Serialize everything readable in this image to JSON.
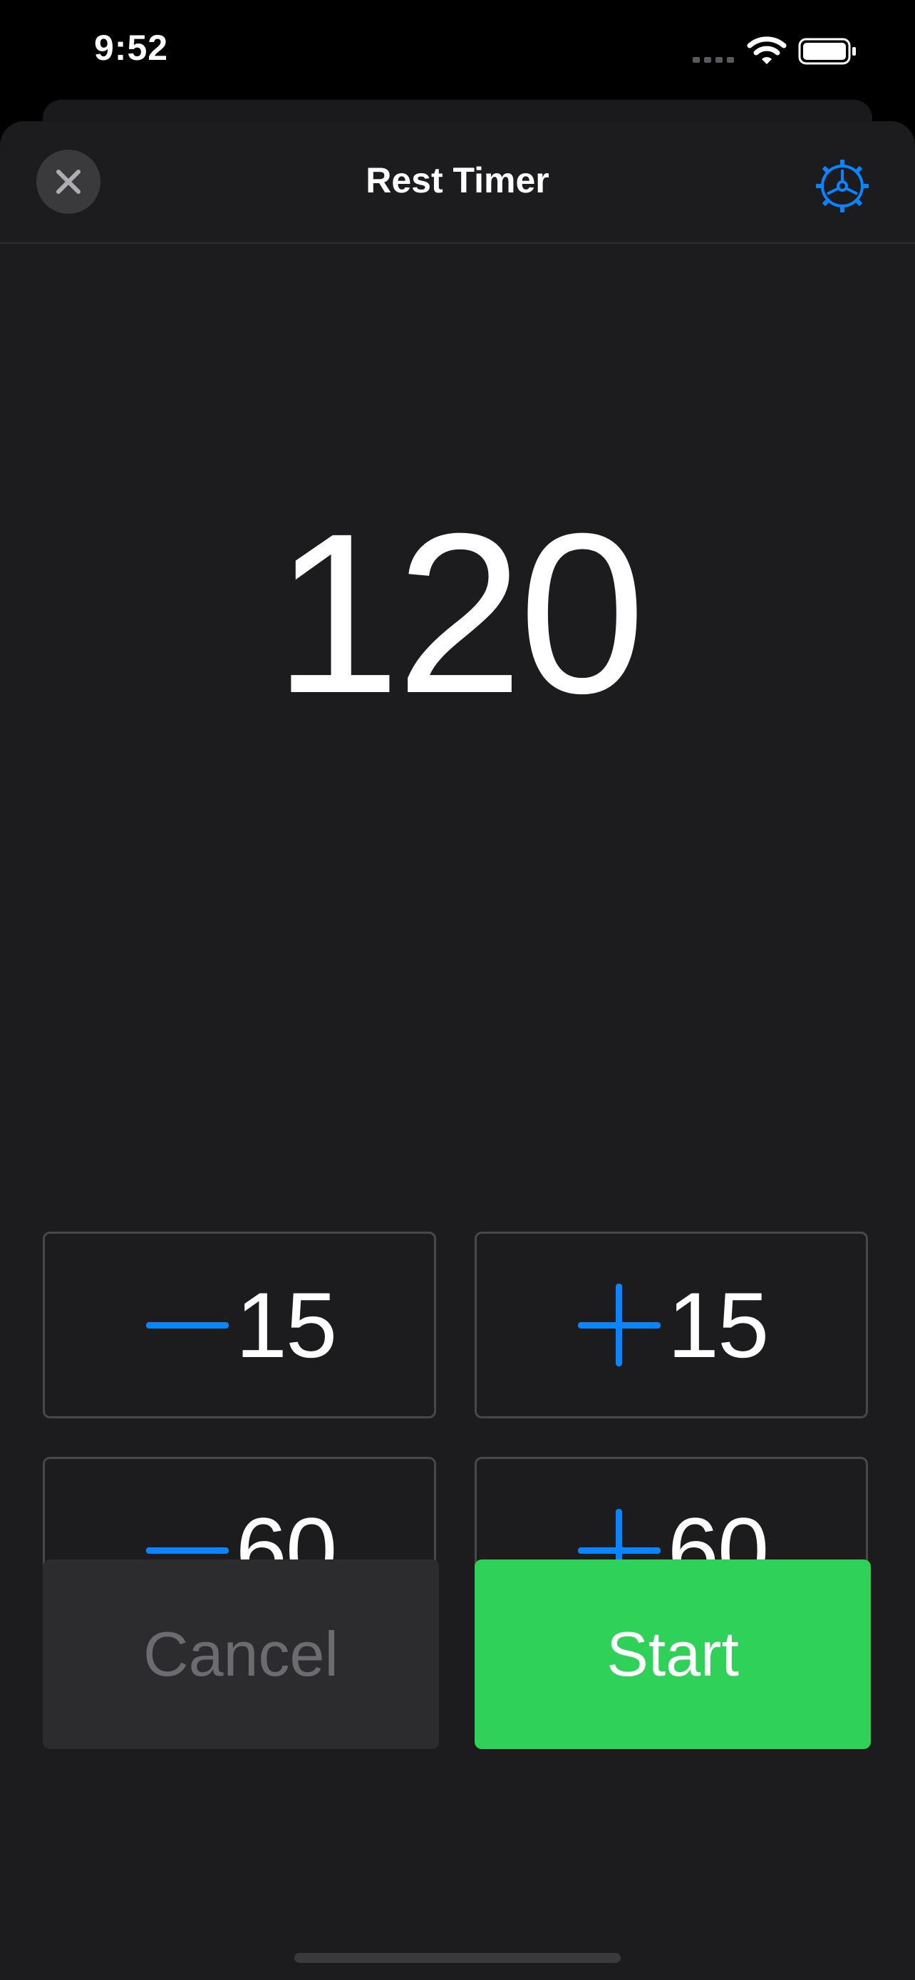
{
  "status_bar": {
    "time": "9:52",
    "icons": [
      "cellular-signal-icon",
      "wifi-icon",
      "battery-icon"
    ]
  },
  "header": {
    "title": "Rest Timer",
    "close_icon": "close-icon",
    "settings_icon": "gear-icon"
  },
  "timer": {
    "value": "120"
  },
  "adjust_buttons": [
    {
      "sign": "minus",
      "amount": "15"
    },
    {
      "sign": "plus",
      "amount": "15"
    },
    {
      "sign": "minus",
      "amount": "60"
    },
    {
      "sign": "plus",
      "amount": "60"
    }
  ],
  "actions": {
    "cancel_label": "Cancel",
    "start_label": "Start"
  },
  "colors": {
    "accent": "#0a84ff",
    "start_green": "#30d158",
    "background": "#1c1c1e"
  }
}
